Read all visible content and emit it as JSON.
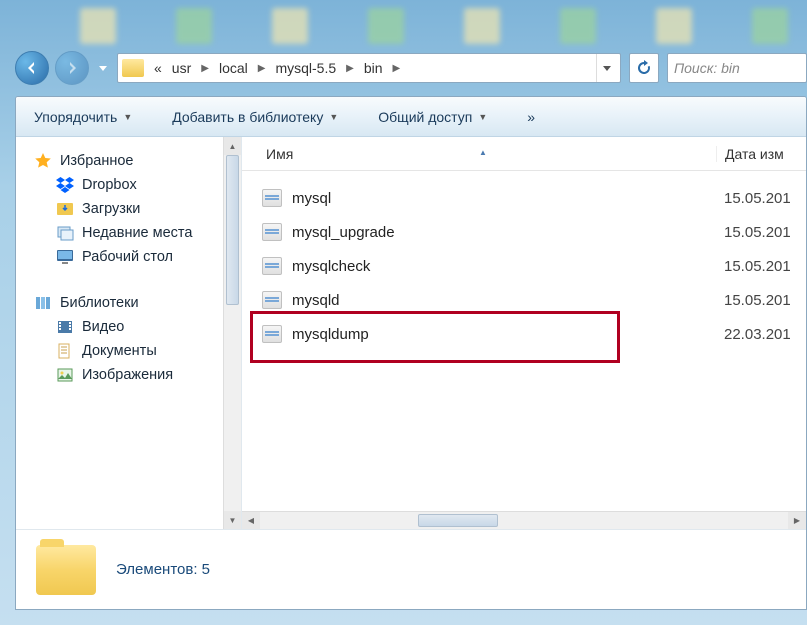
{
  "breadcrumb": {
    "prefix": "«",
    "items": [
      "usr",
      "local",
      "mysql-5.5",
      "bin"
    ]
  },
  "search": {
    "placeholder": "Поиск: bin"
  },
  "toolbar": {
    "organize": "Упорядочить",
    "add_library": "Добавить в библиотеку",
    "share": "Общий доступ",
    "more": "»"
  },
  "sidebar": {
    "favorites": {
      "label": "Избранное",
      "items": [
        {
          "label": "Dropbox",
          "icon": "dropbox-icon"
        },
        {
          "label": "Загрузки",
          "icon": "download-icon"
        },
        {
          "label": "Недавние места",
          "icon": "recent-icon"
        },
        {
          "label": "Рабочий стол",
          "icon": "desktop-icon"
        }
      ]
    },
    "libraries": {
      "label": "Библиотеки",
      "items": [
        {
          "label": "Видео",
          "icon": "video-icon"
        },
        {
          "label": "Документы",
          "icon": "documents-icon"
        },
        {
          "label": "Изображения",
          "icon": "images-icon"
        }
      ]
    }
  },
  "columns": {
    "name": "Имя",
    "date": "Дата изм"
  },
  "files": [
    {
      "name": "mysql",
      "date": "15.05.201"
    },
    {
      "name": "mysql_upgrade",
      "date": "15.05.201"
    },
    {
      "name": "mysqlcheck",
      "date": "15.05.201"
    },
    {
      "name": "mysqld",
      "date": "15.05.201"
    },
    {
      "name": "mysqldump",
      "date": "22.03.201"
    }
  ],
  "highlighted_file_index": 4,
  "status": {
    "label": "Элементов: 5"
  }
}
